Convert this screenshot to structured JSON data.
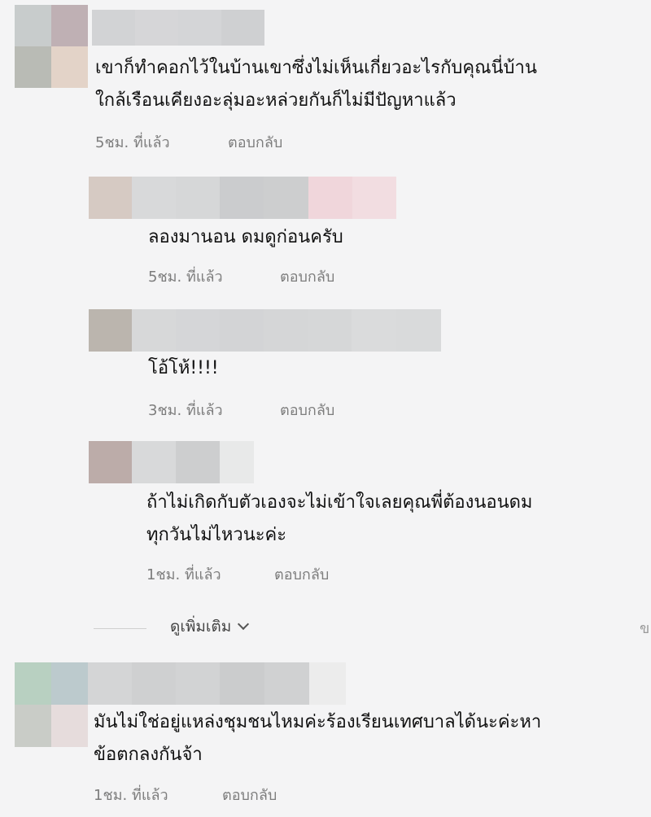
{
  "comments": [
    {
      "text_lines": [
        "เขาก็ทำคอกไว้ในบ้านเขาซึ่งไม่เห็นเกี่ยวอะไรกับคุณนี่บ้าน",
        "ใกล้เรือนเคียงอะลุ่มอะหล่วยกันก็ไม่มีปัญหาแล้ว"
      ],
      "time": "5ชม. ที่แล้ว",
      "reply": "ตอบกลับ"
    },
    {
      "text_lines": [
        "ลองมานอน ดมดูก่อนครับ"
      ],
      "time": "5ชม. ที่แล้ว",
      "reply": "ตอบกลับ"
    },
    {
      "text_lines": [
        "โอ้โห้!!!!"
      ],
      "time": "3ชม. ที่แล้ว",
      "reply": "ตอบกลับ"
    },
    {
      "text_lines": [
        "ถ้าไม่เกิดกับตัวเองจะไม่เข้าใจเลยคุณพี่ต้องนอนดม",
        "ทุกวันไม่ไหวนะค่ะ"
      ],
      "time": "1ชม. ที่แล้ว",
      "reply": "ตอบกลับ"
    },
    {
      "text_lines": [
        "มันไม่ใช่อยู่แหล่งชุมชนไหมค่ะร้องเรียนเทศบาลได้นะค่ะหา",
        "ข้อตกลงกันจ้า"
      ],
      "time": "1ชม. ที่แล้ว",
      "reply": "ตอบกลับ"
    }
  ],
  "view_more": {
    "label": "ดูเพิ่มเติม",
    "icon": "chevron-down-icon"
  },
  "edge_glyph": "ข",
  "colors": {
    "background": "#f4f4f5",
    "text": "#111111",
    "meta": "#7d7d7d"
  }
}
